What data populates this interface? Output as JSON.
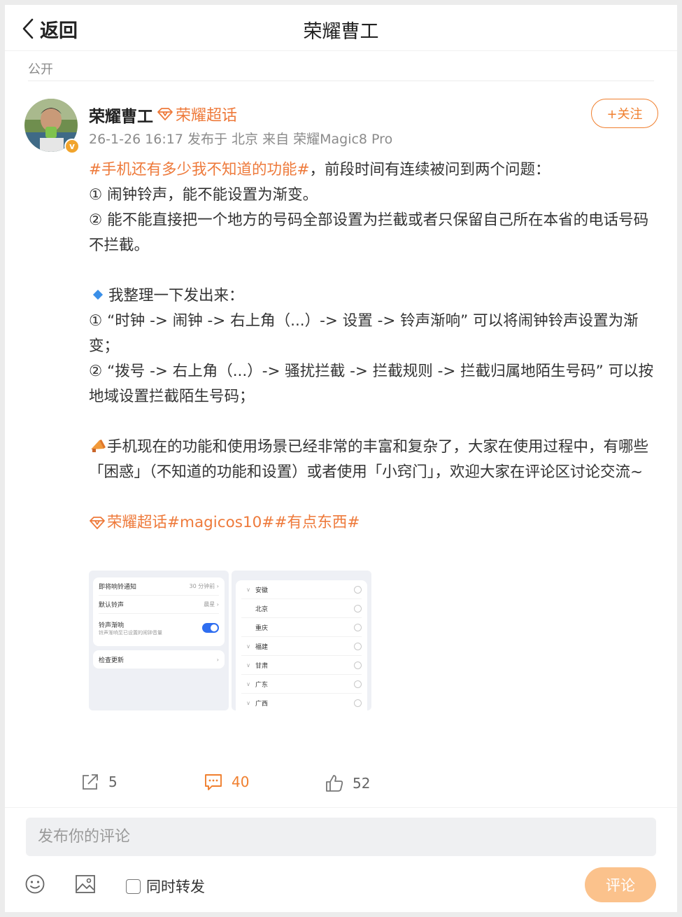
{
  "header": {
    "back_label": "返回",
    "title": "荣耀曹工"
  },
  "visibility": "公开",
  "author": {
    "name": "荣耀曹工",
    "supertopic": "荣耀超话",
    "meta": "26-1-26 16:17  发布于 北京  来自 荣耀Magic8 Pro",
    "follow_label": "+关注",
    "verified_badge": "v"
  },
  "post": {
    "line1_tag": "#手机还有多少我不知道的功能#",
    "line1_text": "，前段时间有连续被问到两个问题：",
    "q1": " ① 闹钟铃声，能不能设置为渐变。",
    "q2": " ② 能不能直接把一个地方的号码全部设置为拦截或者只保留自己所在本省的电话号码不拦截。",
    "summary": "我整理一下发出来：",
    "a1": " ① “时钟 -> 闹钟 -> 右上角（...）-> 设置 -> 铃声渐响” 可以将闹钟铃声设置为渐变；",
    "a2": " ② “拨号 -> 右上角（...）-> 骚扰拦截 -> 拦截规则 -> 拦截归属地陌生号码” 可以按地域设置拦截陌生号码；",
    "closing": "手机现在的功能和使用场景已经非常的丰富和复杂了，大家在使用过程中，有哪些 「困惑」（不知道的功能和设置）或者使用「小窍门」，欢迎大家在评论区讨论交流~",
    "tags": [
      "荣耀超话",
      "#magicos10#",
      "#有点东西#"
    ]
  },
  "image1": {
    "rows": [
      {
        "label": "即将响铃通知",
        "value": "30 分钟前 ›"
      },
      {
        "label": "默认铃声",
        "value": "晨星 ›"
      }
    ],
    "toggle_label": "铃声渐响",
    "toggle_sub": "铃声渐响至已设置的闹钟音量",
    "update_label": "检查更新"
  },
  "image2": {
    "provinces": [
      {
        "name": "安徽",
        "chev": "∨"
      },
      {
        "name": "北京",
        "chev": ""
      },
      {
        "name": "重庆",
        "chev": ""
      },
      {
        "name": "福建",
        "chev": "∨"
      },
      {
        "name": "甘肃",
        "chev": "∨"
      },
      {
        "name": "广东",
        "chev": "∨"
      },
      {
        "name": "广西",
        "chev": "∨"
      }
    ]
  },
  "actions": {
    "reposts": "5",
    "comments": "40",
    "likes": "52"
  },
  "composer": {
    "placeholder": "发布你的评论",
    "repost_label": "同时转发",
    "submit_label": "评论"
  },
  "colors": {
    "accent": "#ee7a3b",
    "submit_disabled": "#fbc28c",
    "toggle_on": "#2f6ef0"
  }
}
